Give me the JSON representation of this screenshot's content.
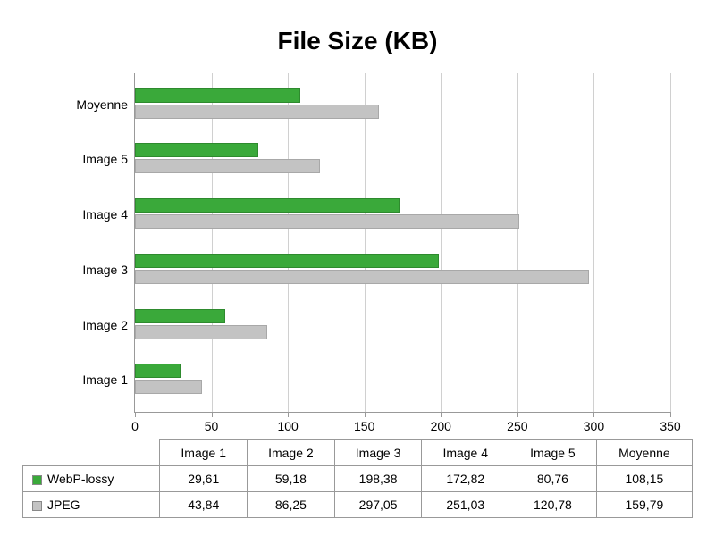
{
  "chart_data": {
    "type": "bar",
    "orientation": "horizontal",
    "title": "File Size (KB)",
    "categories": [
      "Image 1",
      "Image 2",
      "Image 3",
      "Image 4",
      "Image 5",
      "Moyenne"
    ],
    "series": [
      {
        "name": "WebP-lossy",
        "color": "#3aa93a",
        "values": [
          29.61,
          59.18,
          198.38,
          172.82,
          80.76,
          108.15
        ]
      },
      {
        "name": "JPEG",
        "color": "#c3c3c3",
        "values": [
          43.84,
          86.25,
          297.05,
          251.03,
          120.78,
          159.79
        ]
      }
    ],
    "xlim": [
      0,
      350
    ],
    "xticks": [
      0,
      50,
      100,
      150,
      200,
      250,
      300,
      350
    ],
    "decimal_separator": ","
  },
  "table": {
    "headers": [
      "Image 1",
      "Image 2",
      "Image 3",
      "Image 4",
      "Image 5",
      "Moyenne"
    ],
    "rows": [
      {
        "label": "WebP-lossy",
        "class": "webp",
        "values": [
          "29,61",
          "59,18",
          "198,38",
          "172,82",
          "80,76",
          "108,15"
        ]
      },
      {
        "label": "JPEG",
        "class": "jpeg",
        "values": [
          "43,84",
          "86,25",
          "297,05",
          "251,03",
          "120,78",
          "159,79"
        ]
      }
    ]
  }
}
